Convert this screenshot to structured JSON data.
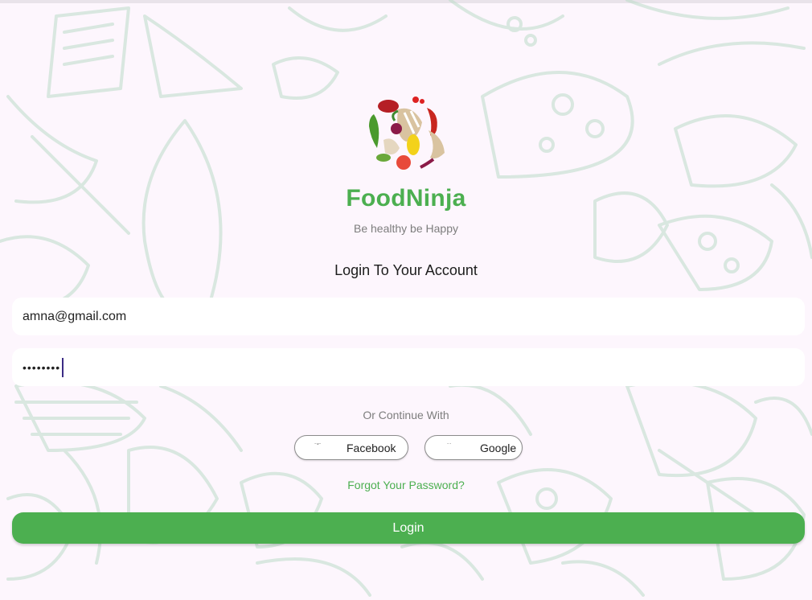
{
  "app": {
    "name": "FoodNinja",
    "tagline": "Be healthy be Happy"
  },
  "form": {
    "heading": "Login To Your Account",
    "email_value": "amna@gmail.com",
    "password_value": "••••••••"
  },
  "social": {
    "divider_text": "Or Continue With",
    "facebook_label": "Facebook",
    "google_label": "Google"
  },
  "links": {
    "forgot_password": "Forgot Your Password?"
  },
  "actions": {
    "login_label": "Login"
  },
  "colors": {
    "brand_green": "#4caf50",
    "background": "#fdf6fd",
    "pattern": "#bcdcc9"
  },
  "icons": {
    "logo": "food-ninja-logo",
    "facebook": "facebook-icon",
    "google": "google-icon"
  }
}
